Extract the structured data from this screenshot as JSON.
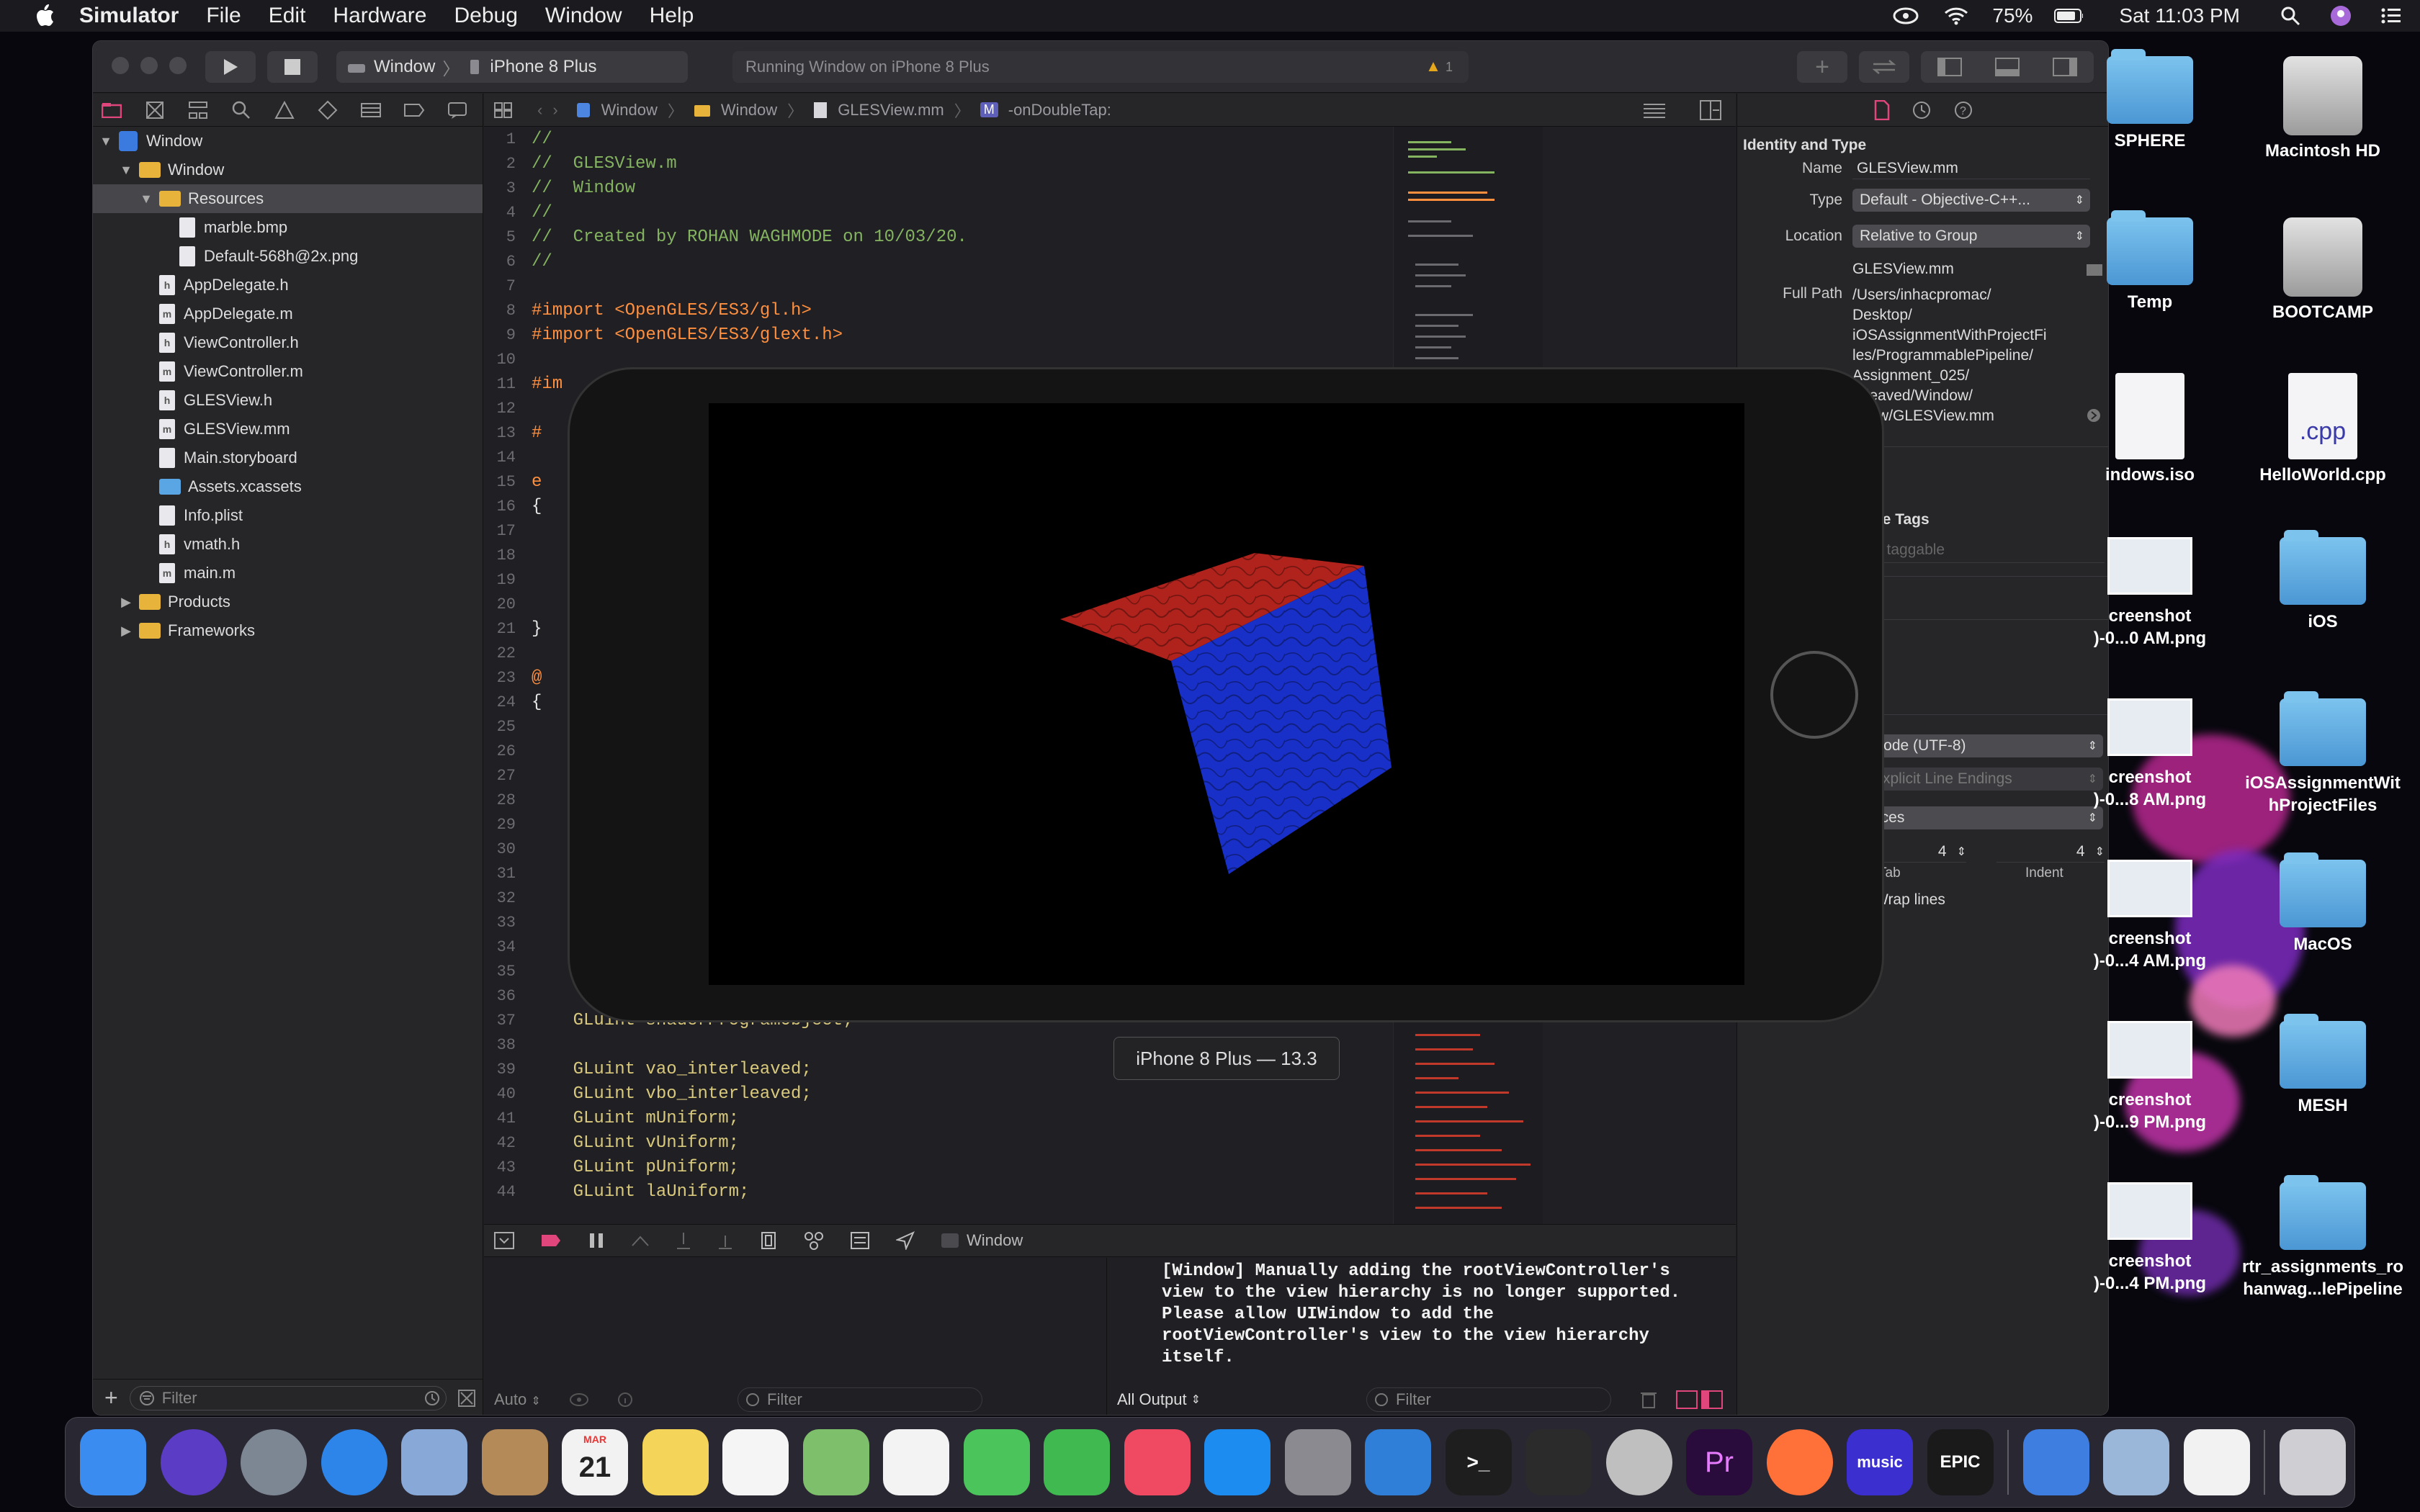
{
  "menubar": {
    "app_name": "Simulator",
    "items": [
      "File",
      "Edit",
      "Hardware",
      "Debug",
      "Window",
      "Help"
    ],
    "battery": "75%",
    "clock": "Sat 11:03 PM"
  },
  "toolbar": {
    "scheme": "Window",
    "destination": "iPhone 8 Plus",
    "activity": "Running Window on iPhone 8 Plus",
    "warning_count": "1"
  },
  "navigator": {
    "rows": [
      {
        "label": "Window",
        "kind": "project",
        "indent": 0,
        "disclosure": "▼"
      },
      {
        "label": "Window",
        "kind": "folder",
        "indent": 1,
        "disclosure": "▼"
      },
      {
        "label": "Resources",
        "kind": "folder",
        "indent": 2,
        "disclosure": "▼",
        "selected": true
      },
      {
        "label": "marble.bmp",
        "kind": "file",
        "indent": 3,
        "disclosure": ""
      },
      {
        "label": "Default-568h@2x.png",
        "kind": "file",
        "indent": 3,
        "disclosure": ""
      },
      {
        "label": "AppDelegate.h",
        "kind": "file",
        "indent": 2,
        "disclosure": "",
        "badge": "h"
      },
      {
        "label": "AppDelegate.m",
        "kind": "file",
        "indent": 2,
        "disclosure": "",
        "badge": "m"
      },
      {
        "label": "ViewController.h",
        "kind": "file",
        "indent": 2,
        "disclosure": "",
        "badge": "h"
      },
      {
        "label": "ViewController.m",
        "kind": "file",
        "indent": 2,
        "disclosure": "",
        "badge": "m"
      },
      {
        "label": "GLESView.h",
        "kind": "file",
        "indent": 2,
        "disclosure": "",
        "badge": "h"
      },
      {
        "label": "GLESView.mm",
        "kind": "file",
        "indent": 2,
        "disclosure": "",
        "badge": "m"
      },
      {
        "label": "Main.storyboard",
        "kind": "file",
        "indent": 2,
        "disclosure": ""
      },
      {
        "label": "Assets.xcassets",
        "kind": "folder-blue",
        "indent": 2,
        "disclosure": ""
      },
      {
        "label": "Info.plist",
        "kind": "file",
        "indent": 2,
        "disclosure": ""
      },
      {
        "label": "vmath.h",
        "kind": "file",
        "indent": 2,
        "disclosure": "",
        "badge": "h"
      },
      {
        "label": "main.m",
        "kind": "file",
        "indent": 2,
        "disclosure": "",
        "badge": "m"
      },
      {
        "label": "Products",
        "kind": "folder",
        "indent": 1,
        "disclosure": "▶"
      },
      {
        "label": "Frameworks",
        "kind": "folder",
        "indent": 1,
        "disclosure": "▶"
      }
    ],
    "filter_placeholder": "Filter"
  },
  "jumpbar": {
    "crumbs": [
      "Window",
      "Window",
      "GLESView.mm",
      "-onDoubleTap:"
    ],
    "method_badge": "M"
  },
  "code": {
    "lines": [
      {
        "n": "1",
        "t": "//",
        "c": "comment"
      },
      {
        "n": "2",
        "t": "//  GLESView.m",
        "c": "comment"
      },
      {
        "n": "3",
        "t": "//  Window",
        "c": "comment"
      },
      {
        "n": "4",
        "t": "//",
        "c": "comment"
      },
      {
        "n": "5",
        "t": "//  Created by ROHAN WAGHMODE on 10/03/20.",
        "c": "comment"
      },
      {
        "n": "6",
        "t": "//",
        "c": "comment"
      },
      {
        "n": "7",
        "t": "",
        "c": ""
      },
      {
        "n": "8",
        "t": "#import <OpenGLES/ES3/gl.h>",
        "c": "macro"
      },
      {
        "n": "9",
        "t": "#import <OpenGLES/ES3/glext.h>",
        "c": "macro"
      },
      {
        "n": "10",
        "t": "",
        "c": ""
      },
      {
        "n": "11",
        "t": "#im",
        "c": "macro"
      },
      {
        "n": "12",
        "t": "",
        "c": ""
      },
      {
        "n": "13",
        "t": "#",
        "c": "macro"
      },
      {
        "n": "14",
        "t": "",
        "c": ""
      },
      {
        "n": "15",
        "t": "e",
        "c": "macro"
      },
      {
        "n": "16",
        "t": "{",
        "c": ""
      },
      {
        "n": "17",
        "t": "",
        "c": ""
      },
      {
        "n": "18",
        "t": "",
        "c": ""
      },
      {
        "n": "19",
        "t": "",
        "c": ""
      },
      {
        "n": "20",
        "t": "",
        "c": ""
      },
      {
        "n": "21",
        "t": "}",
        "c": ""
      },
      {
        "n": "22",
        "t": "",
        "c": ""
      },
      {
        "n": "23",
        "t": "@",
        "c": "macro"
      },
      {
        "n": "24",
        "t": "{",
        "c": ""
      },
      {
        "n": "25",
        "t": "",
        "c": ""
      },
      {
        "n": "26",
        "t": "",
        "c": ""
      },
      {
        "n": "27",
        "t": "",
        "c": ""
      },
      {
        "n": "28",
        "t": "",
        "c": ""
      },
      {
        "n": "29",
        "t": "",
        "c": ""
      },
      {
        "n": "30",
        "t": "",
        "c": ""
      },
      {
        "n": "31",
        "t": "",
        "c": ""
      },
      {
        "n": "32",
        "t": "",
        "c": ""
      },
      {
        "n": "33",
        "t": "",
        "c": ""
      },
      {
        "n": "34",
        "t": "",
        "c": ""
      },
      {
        "n": "35",
        "t": "",
        "c": ""
      },
      {
        "n": "36",
        "t": "",
        "c": ""
      },
      {
        "n": "37",
        "t": "    GLuint shaderProgramObject;",
        "c": "type"
      },
      {
        "n": "38",
        "t": "",
        "c": ""
      },
      {
        "n": "39",
        "t": "    GLuint vao_interleaved;",
        "c": "type"
      },
      {
        "n": "40",
        "t": "    GLuint vbo_interleaved;",
        "c": "type"
      },
      {
        "n": "41",
        "t": "    GLuint mUniform;",
        "c": "type"
      },
      {
        "n": "42",
        "t": "    GLuint vUniform;",
        "c": "type"
      },
      {
        "n": "43",
        "t": "    GLuint pUniform;",
        "c": "type"
      },
      {
        "n": "44",
        "t": "    GLuint laUniform;",
        "c": "type"
      }
    ]
  },
  "inspector": {
    "section_title": "Identity and Type",
    "name_label": "Name",
    "name_value": "GLESView.mm",
    "type_label": "Type",
    "type_value": "Default - Objective-C++...",
    "location_label": "Location",
    "location_value": "Relative to Group",
    "file_name": "GLESView.mm",
    "full_path_label": "Full Path",
    "full_path": [
      "/Users/inhacpromac/",
      "Desktop/",
      "iOSAssignmentWithProjectFi",
      "les/ProgrammablePipeline/",
      "Assignment_025/",
      "erleaved/Window/",
      "ndow/GLESView.mm"
    ],
    "tags_title": "ce Tags",
    "tags_placeholder": "e taggable",
    "encoding": "icode (UTF-8)",
    "line_endings": "Explicit Line Endings",
    "indent_using": "aces",
    "tab_value": "4",
    "indent_value": "4",
    "tab_label": "Tab",
    "indent_label": "Indent",
    "wrap_label": "Wrap lines"
  },
  "debug": {
    "target": "Window",
    "auto_label": "Auto",
    "filter_placeholder": "Filter",
    "output_label": "All Output",
    "console": [
      "[Window] Manually adding the rootViewController's",
      "view to the view hierarchy is no longer supported.",
      "Please allow UIWindow to add the",
      "rootViewController's view to the view hierarchy",
      "itself."
    ]
  },
  "simulator": {
    "device_label": "iPhone 8 Plus — 13.3",
    "cube_top_color": "#b0221c",
    "cube_side_color": "#1830c8"
  },
  "desktop": [
    {
      "label": "SPHERE",
      "kind": "folder"
    },
    {
      "label": "Macintosh HD",
      "kind": "disk"
    },
    {
      "label": "Temp",
      "kind": "folder"
    },
    {
      "label": "BOOTCAMP",
      "kind": "disk"
    },
    {
      "label": "indows.iso",
      "kind": "doc"
    },
    {
      "label": "HelloWorld.cpp",
      "kind": "doc",
      "doc_text": ".cpp"
    },
    {
      "label": "creenshot\n)-0...0 AM.png",
      "kind": "shot"
    },
    {
      "label": "iOS",
      "kind": "folder"
    },
    {
      "label": "creenshot\n)-0...8 AM.png",
      "kind": "shot"
    },
    {
      "label": "iOSAssignmentWit\nhProjectFiles",
      "kind": "folder"
    },
    {
      "label": "creenshot\n)-0...4 AM.png",
      "kind": "shot"
    },
    {
      "label": "MacOS",
      "kind": "folder"
    },
    {
      "label": "creenshot\n)-0...9 PM.png",
      "kind": "shot"
    },
    {
      "label": "MESH",
      "kind": "folder"
    },
    {
      "label": "creenshot\n)-0...4 PM.png",
      "kind": "shot"
    },
    {
      "label": "rtr_assignments_ro\nhanwag...lePipeline",
      "kind": "folder"
    }
  ],
  "dock": [
    {
      "name": "finder-icon",
      "bg": "#3b8cf0",
      "text": ""
    },
    {
      "name": "siri-icon",
      "bg": "#5b3cc4",
      "text": ""
    },
    {
      "name": "launchpad-icon",
      "bg": "#7d8794",
      "text": ""
    },
    {
      "name": "safari-icon",
      "bg": "#2d85e9",
      "text": ""
    },
    {
      "name": "mail-bird-icon",
      "bg": "#88a8d8",
      "text": ""
    },
    {
      "name": "contacts-icon",
      "bg": "#b38a58",
      "text": ""
    },
    {
      "name": "calendar-icon",
      "bg": "#f2f2f2",
      "text": "21",
      "month": "MAR"
    },
    {
      "name": "notes-icon",
      "bg": "#f5d45a",
      "text": ""
    },
    {
      "name": "reminders-icon",
      "bg": "#f5f5f5",
      "text": ""
    },
    {
      "name": "maps-icon",
      "bg": "#7dbf6b",
      "text": ""
    },
    {
      "name": "photos-icon",
      "bg": "#f3f3f3",
      "text": ""
    },
    {
      "name": "messages-icon",
      "bg": "#4cc45c",
      "text": ""
    },
    {
      "name": "facetime-icon",
      "bg": "#3fb950",
      "text": ""
    },
    {
      "name": "music-icon",
      "bg": "#f04a63",
      "text": ""
    },
    {
      "name": "app-store-icon",
      "bg": "#1d8cf0",
      "text": ""
    },
    {
      "name": "system-preferences-icon",
      "bg": "#8a8a90",
      "text": ""
    },
    {
      "name": "xcode-icon",
      "bg": "#2f7fd8",
      "text": ""
    },
    {
      "name": "terminal-icon",
      "bg": "#1e1e1e",
      "text": ">_"
    },
    {
      "name": "final-cut-icon",
      "bg": "#2b2b2b",
      "text": ""
    },
    {
      "name": "disk-utility-icon",
      "bg": "#bfbfbf",
      "text": ""
    },
    {
      "name": "premiere-icon",
      "bg": "#2a0c3c",
      "text": "Pr"
    },
    {
      "name": "firefox-icon",
      "bg": "#ff7139",
      "text": ""
    },
    {
      "name": "amazon-music-icon",
      "bg": "#3c2fd0",
      "text": "music"
    },
    {
      "name": "epic-games-icon",
      "bg": "#1a1a1a",
      "text": "EPIC"
    },
    {
      "name": "simulator-icon",
      "bg": "#3d7ee0",
      "text": ""
    },
    {
      "name": "preview-icon",
      "bg": "#9ab6d8",
      "text": ""
    },
    {
      "name": "textedit-icon",
      "bg": "#f2f2f2",
      "text": ""
    },
    {
      "name": "trash-icon",
      "bg": "#cfcfd3",
      "text": ""
    }
  ]
}
